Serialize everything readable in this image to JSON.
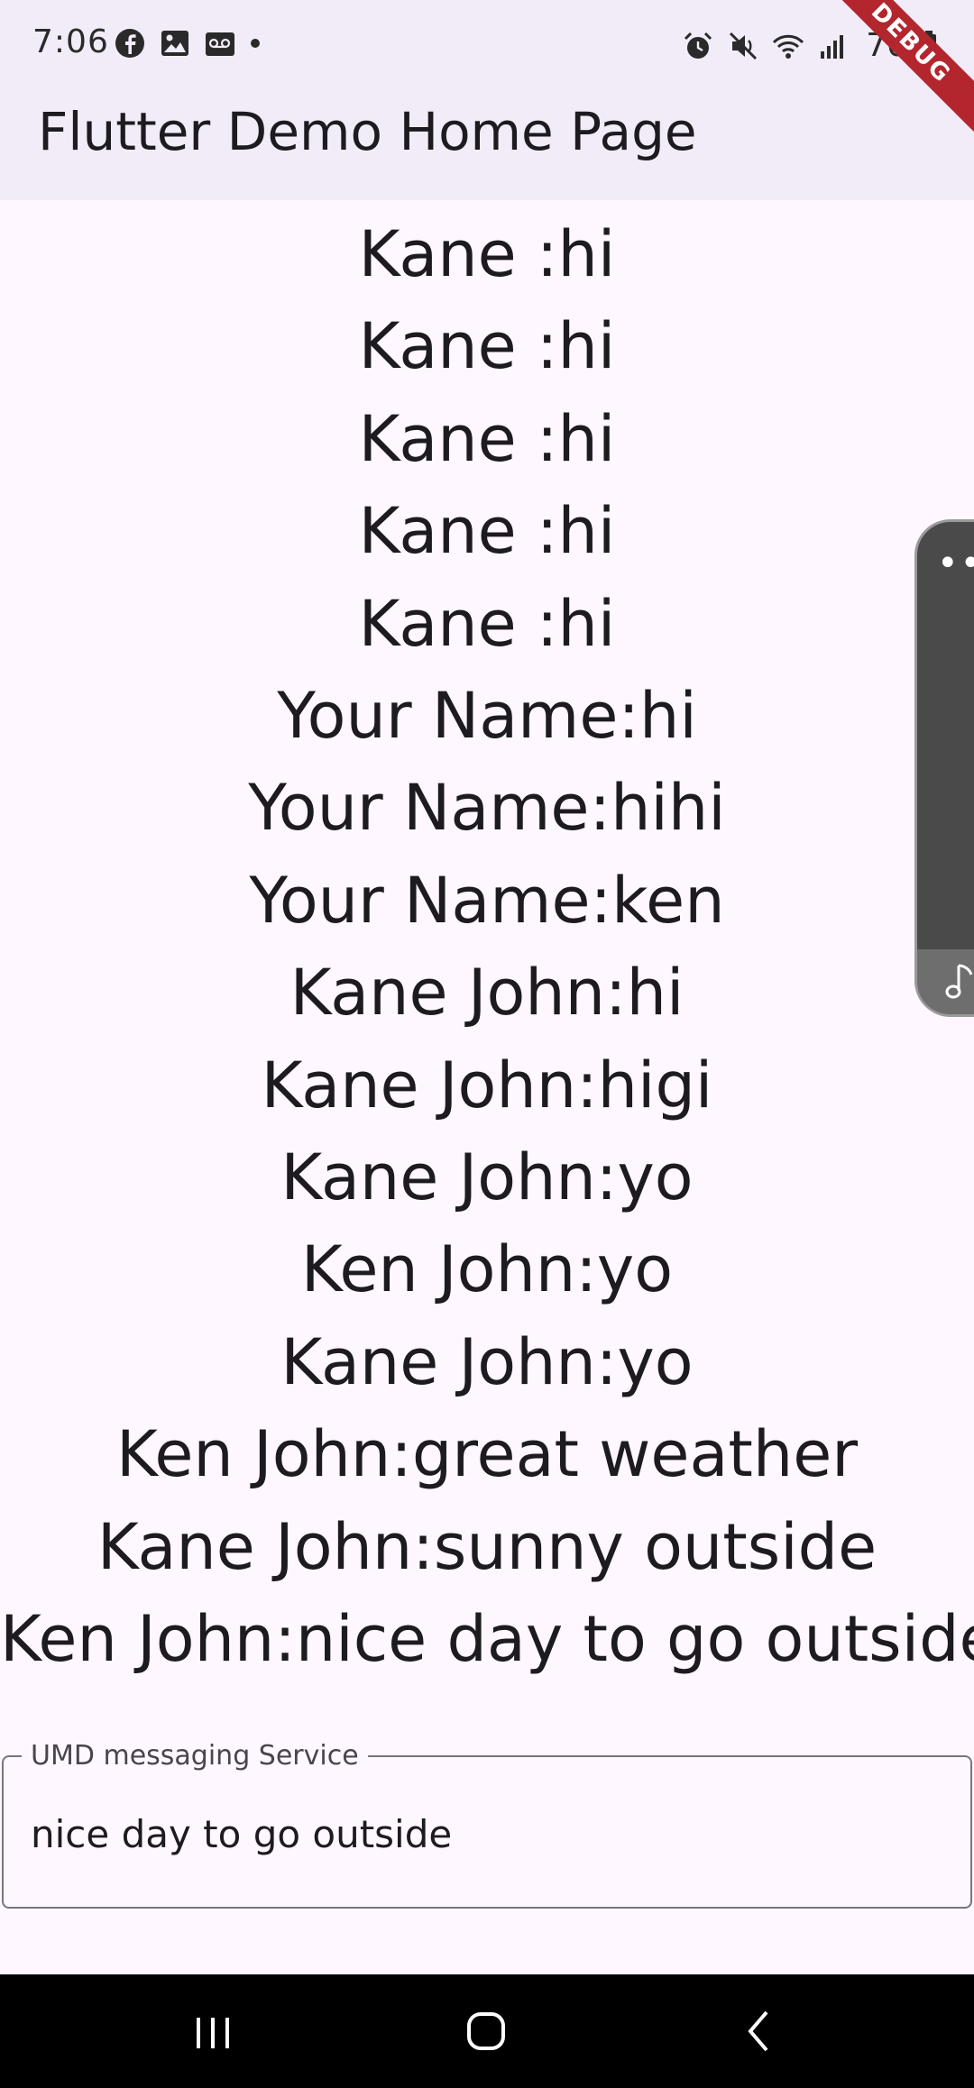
{
  "status_bar": {
    "time": "7:06",
    "battery": "70",
    "left_icons": [
      "facebook-icon",
      "gallery-icon",
      "voicemail-icon",
      "dot-icon"
    ],
    "right_icons": [
      "alarm-icon",
      "mute-icon",
      "wifi-icon",
      "signal-icon",
      "battery-icon"
    ]
  },
  "app_bar": {
    "title": "Flutter Demo Home Page",
    "background": "#f2ecf8"
  },
  "debug_banner": {
    "label": "DEBUG",
    "color": "#b3262d"
  },
  "messages": [
    "Kane :hi",
    "Kane :hi",
    "Kane :hi",
    "Kane :hi",
    "Kane :hi",
    "Your Name:hi",
    "Your Name:hihi",
    "Your Name:ken",
    "Kane John:hi",
    "Kane John:higi",
    "Kane John:yo",
    "Ken John:yo",
    "Kane John:yo",
    "Ken John:great weather",
    "Kane John:sunny  outside",
    "Ken John:nice day to go outside"
  ],
  "message_input": {
    "label": "UMD messaging Service",
    "value": "nice day to go outside"
  },
  "side_widget": {
    "icons": [
      "more-dots-icon",
      "music-note-icon"
    ]
  },
  "nav_bar": {
    "buttons": [
      "recent-apps-button",
      "home-button",
      "back-button"
    ]
  }
}
